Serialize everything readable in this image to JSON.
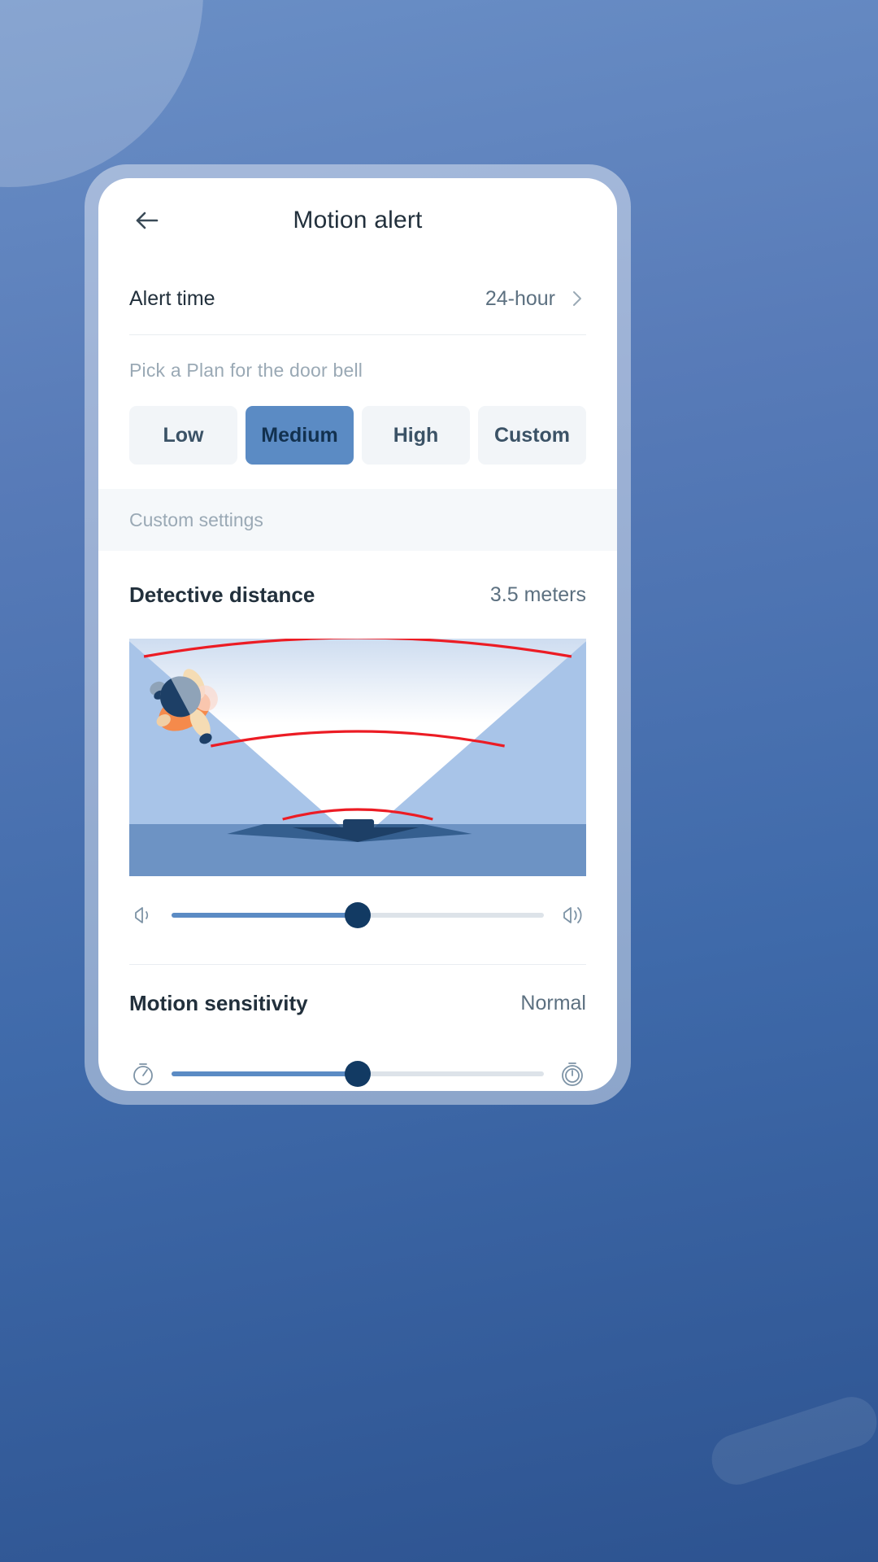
{
  "appbar": {
    "title": "Motion alert",
    "back_icon": "arrow-left-icon"
  },
  "alert_time": {
    "label": "Alert time",
    "value": "24-hour",
    "chevron_icon": "chevron-right-icon"
  },
  "plan": {
    "caption": "Pick a Plan for the door bell",
    "options": [
      {
        "label": "Low",
        "selected": false
      },
      {
        "label": "Medium",
        "selected": true
      },
      {
        "label": "High",
        "selected": false
      },
      {
        "label": "Custom",
        "selected": false
      }
    ]
  },
  "custom_settings": {
    "band_label": "Custom settings"
  },
  "detective_distance": {
    "label": "Detective distance",
    "value": "3.5 meters",
    "slider": {
      "percent": 50,
      "left_icon": "volume-low-icon",
      "right_icon": "volume-high-icon"
    }
  },
  "motion_sensitivity": {
    "label": "Motion sensitivity",
    "value": "Normal",
    "slider": {
      "percent": 50,
      "left_icon": "stopwatch-fast-icon",
      "right_icon": "stopwatch-slow-icon"
    }
  },
  "colors": {
    "accent": "#5b8bc4",
    "thumb": "#123a63",
    "arc": "#ec1c24",
    "background": "#3f6aaa",
    "card": "#ffffff"
  }
}
